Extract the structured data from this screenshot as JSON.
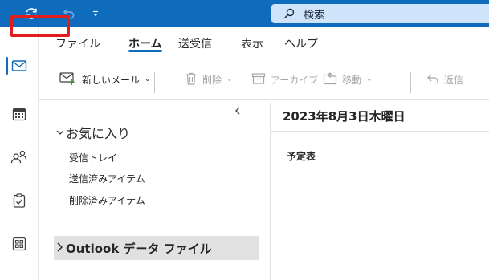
{
  "titlebar": {
    "search_placeholder": "検索",
    "icons": [
      "sync-icon",
      "undo-icon",
      "quick-access-dropdown-icon",
      "search-icon"
    ],
    "accent_color": "#0f6cbd"
  },
  "nav_rail": {
    "items": [
      "mail-icon",
      "calendar-icon",
      "people-icon",
      "todo-icon",
      "apps-icon"
    ],
    "active": "mail-icon"
  },
  "ribbon": {
    "tabs": [
      {
        "label": "ファイル"
      },
      {
        "label": "ホーム"
      },
      {
        "label": "送受信"
      },
      {
        "label": "表示"
      },
      {
        "label": "ヘルプ"
      }
    ],
    "active_tab": "ホーム",
    "highlight_color": "#e21b1b",
    "toolbar": {
      "new_mail": "新しいメール",
      "delete": "削除",
      "archive": "アーカイブ",
      "move": "移動",
      "reply": "返信"
    }
  },
  "folder_pane": {
    "favorites_header": "お気に入り",
    "folders": [
      "受信トレイ",
      "送信済みアイテム",
      "削除済みアイテム"
    ],
    "data_file": "Outlook データ ファイル"
  },
  "calendar": {
    "date_header": "2023年8月3日木曜日",
    "schedule_label": "予定表"
  }
}
